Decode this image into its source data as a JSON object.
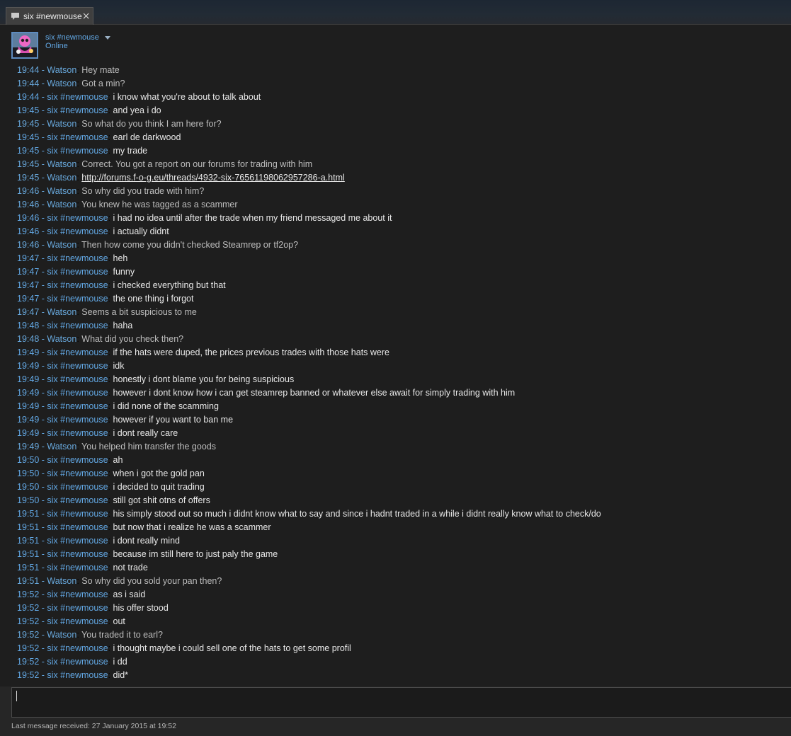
{
  "tab": {
    "label": "six #newmouse",
    "close": "×"
  },
  "header": {
    "name": "six #newmouse",
    "status": "Online"
  },
  "messages": [
    {
      "time": "19:44",
      "sender": "Watson",
      "role": "watson",
      "text": "Hey mate"
    },
    {
      "time": "19:44",
      "sender": "Watson",
      "role": "watson",
      "text": "Got a min?"
    },
    {
      "time": "19:44",
      "sender": "six #newmouse",
      "role": "self",
      "text": "i know what you're about to talk about"
    },
    {
      "time": "19:45",
      "sender": "six #newmouse",
      "role": "self",
      "text": "and yea i do"
    },
    {
      "time": "19:45",
      "sender": "Watson",
      "role": "watson",
      "text": "So what do you think I am here for?"
    },
    {
      "time": "19:45",
      "sender": "six #newmouse",
      "role": "self",
      "text": "earl de darkwood"
    },
    {
      "time": "19:45",
      "sender": "six #newmouse",
      "role": "self",
      "text": "my trade"
    },
    {
      "time": "19:45",
      "sender": "Watson",
      "role": "watson",
      "text": "Correct. You got a report on our forums for trading with him"
    },
    {
      "time": "19:45",
      "sender": "Watson",
      "role": "watson",
      "text": "http://forums.f-o-g.eu/threads/4932-six-76561198062957286-a.html",
      "link": true
    },
    {
      "time": "19:46",
      "sender": "Watson",
      "role": "watson",
      "text": "So why did you trade with him?"
    },
    {
      "time": "19:46",
      "sender": "Watson",
      "role": "watson",
      "text": "You knew he was tagged as a scammer"
    },
    {
      "time": "19:46",
      "sender": "six #newmouse",
      "role": "self",
      "text": "i had no idea until after the trade when my friend messaged me about it"
    },
    {
      "time": "19:46",
      "sender": "six #newmouse",
      "role": "self",
      "text": "i actually didnt"
    },
    {
      "time": "19:46",
      "sender": "Watson",
      "role": "watson",
      "text": "Then how come you didn't checked Steamrep or tf2op?"
    },
    {
      "time": "19:47",
      "sender": "six #newmouse",
      "role": "self",
      "text": "heh"
    },
    {
      "time": "19:47",
      "sender": "six #newmouse",
      "role": "self",
      "text": "funny"
    },
    {
      "time": "19:47",
      "sender": "six #newmouse",
      "role": "self",
      "text": "i checked everything but that"
    },
    {
      "time": "19:47",
      "sender": "six #newmouse",
      "role": "self",
      "text": "the one thing i forgot"
    },
    {
      "time": "19:47",
      "sender": "Watson",
      "role": "watson",
      "text": "Seems a bit suspicious to me"
    },
    {
      "time": "19:48",
      "sender": "six #newmouse",
      "role": "self",
      "text": "haha"
    },
    {
      "time": "19:48",
      "sender": "Watson",
      "role": "watson",
      "text": "What did you check then?"
    },
    {
      "time": "19:49",
      "sender": "six #newmouse",
      "role": "self",
      "text": "if the hats were duped, the prices previous trades with those hats were"
    },
    {
      "time": "19:49",
      "sender": "six #newmouse",
      "role": "self",
      "text": "idk"
    },
    {
      "time": "19:49",
      "sender": "six #newmouse",
      "role": "self",
      "text": "honestly i dont blame you for being suspicious"
    },
    {
      "time": "19:49",
      "sender": "six #newmouse",
      "role": "self",
      "text": "however i dont know how i can get steamrep banned or whatever else await for simply trading with him"
    },
    {
      "time": "19:49",
      "sender": "six #newmouse",
      "role": "self",
      "text": "i did none of the scamming"
    },
    {
      "time": "19:49",
      "sender": "six #newmouse",
      "role": "self",
      "text": "however if you want to ban me"
    },
    {
      "time": "19:49",
      "sender": "six #newmouse",
      "role": "self",
      "text": "i dont really care"
    },
    {
      "time": "19:49",
      "sender": "Watson",
      "role": "watson",
      "text": "You helped him transfer the goods"
    },
    {
      "time": "19:50",
      "sender": "six #newmouse",
      "role": "self",
      "text": "ah"
    },
    {
      "time": "19:50",
      "sender": "six #newmouse",
      "role": "self",
      "text": "when i got the gold pan"
    },
    {
      "time": "19:50",
      "sender": "six #newmouse",
      "role": "self",
      "text": "i decided to quit trading"
    },
    {
      "time": "19:50",
      "sender": "six #newmouse",
      "role": "self",
      "text": "still got shit otns of offers"
    },
    {
      "time": "19:51",
      "sender": "six #newmouse",
      "role": "self",
      "text": "his simply stood out so much i didnt know what to say and since i hadnt traded in a while i didnt really know what to check/do"
    },
    {
      "time": "19:51",
      "sender": "six #newmouse",
      "role": "self",
      "text": "but now that i realize he was a scammer"
    },
    {
      "time": "19:51",
      "sender": "six #newmouse",
      "role": "self",
      "text": "i dont really mind"
    },
    {
      "time": "19:51",
      "sender": "six #newmouse",
      "role": "self",
      "text": "because im still here to just paly the game"
    },
    {
      "time": "19:51",
      "sender": "six #newmouse",
      "role": "self",
      "text": "not trade"
    },
    {
      "time": "19:51",
      "sender": "Watson",
      "role": "watson",
      "text": "So why did you sold your pan then?"
    },
    {
      "time": "19:52",
      "sender": "six #newmouse",
      "role": "self",
      "text": "as i said"
    },
    {
      "time": "19:52",
      "sender": "six #newmouse",
      "role": "self",
      "text": "his offer stood"
    },
    {
      "time": "19:52",
      "sender": "six #newmouse",
      "role": "self",
      "text": "out"
    },
    {
      "time": "19:52",
      "sender": "Watson",
      "role": "watson",
      "text": "You traded it to earl?"
    },
    {
      "time": "19:52",
      "sender": "six #newmouse",
      "role": "self",
      "text": "i thought maybe i could sell one of the hats to get some profil"
    },
    {
      "time": "19:52",
      "sender": "six #newmouse",
      "role": "self",
      "text": "i dd"
    },
    {
      "time": "19:52",
      "sender": "six #newmouse",
      "role": "self",
      "text": "did*"
    }
  ],
  "input": {
    "value": ""
  },
  "footer": {
    "status": "Last message received: 27 January 2015 at 19:52"
  }
}
